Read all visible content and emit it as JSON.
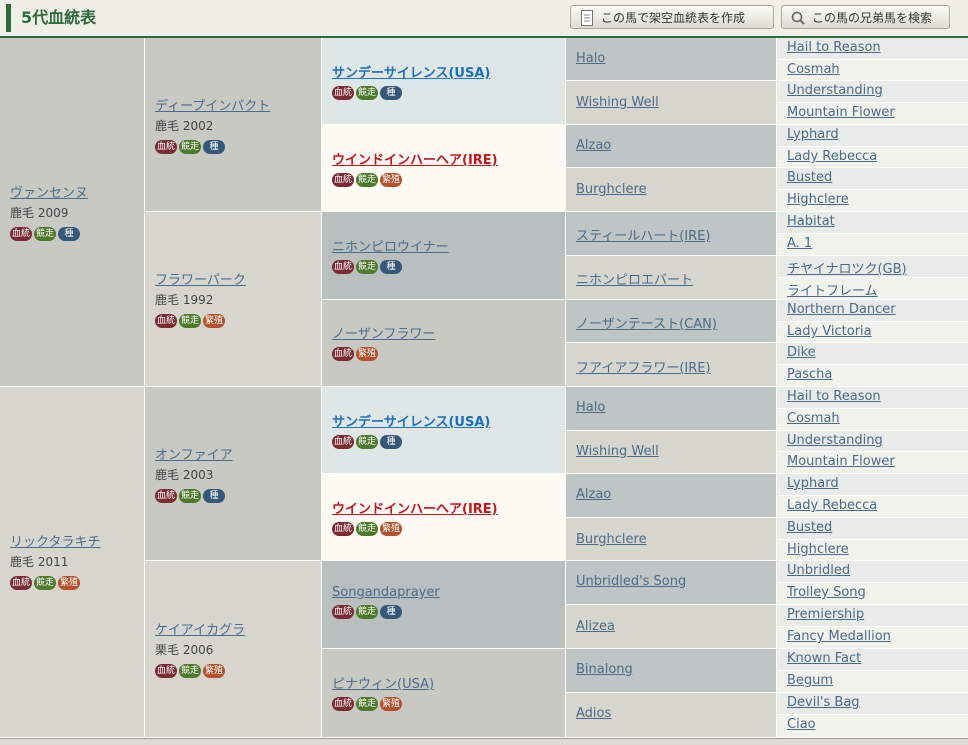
{
  "header": {
    "title": "5代血統表",
    "btn_create": "この馬で架空血統表を作成",
    "btn_search": "この馬の兄弟馬を検索"
  },
  "badges": {
    "blood": "血統",
    "race": "競走",
    "stud": "種",
    "breed": "繁殖"
  },
  "g1": [
    {
      "name": "ヴァンセンヌ",
      "info": "鹿毛 2009"
    },
    {
      "name": "リックタラキチ",
      "info": "鹿毛 2011"
    }
  ],
  "g2": [
    {
      "name": "ディープインパクト",
      "info": "鹿毛 2002"
    },
    {
      "name": "フラワーパーク",
      "info": "鹿毛 1992"
    },
    {
      "name": "オンファイア",
      "info": "鹿毛 2003"
    },
    {
      "name": "ケイアイカグラ",
      "info": "栗毛 2006"
    }
  ],
  "g3": [
    "サンデーサイレンス(USA)",
    "ウインドインハーヘア(IRE)",
    "ニホンピロウイナー",
    "ノーザンフラワー",
    "サンデーサイレンス(USA)",
    "ウインドインハーヘア(IRE)",
    "Songandaprayer",
    "ピナウィン(USA)"
  ],
  "g4": [
    "Halo",
    "Wishing Well",
    "Alzao",
    "Burghclere",
    "スティールハート(IRE)",
    "ニホンピロエバート",
    "ノーザンテースト(CAN)",
    "フアイアフラワー(IRE)",
    "Halo",
    "Wishing Well",
    "Alzao",
    "Burghclere",
    "Unbridled's Song",
    "Alizea",
    "Binalong",
    "Adios"
  ],
  "g5": [
    "Hail to Reason",
    "Cosmah",
    "Understanding",
    "Mountain Flower",
    "Lyphard",
    "Lady Rebecca",
    "Busted",
    "Highclere",
    "Habitat",
    "A. 1",
    "チヤイナロツク(GB)",
    "ライトフレーム",
    "Northern Dancer",
    "Lady Victoria",
    "Dike",
    "Pascha",
    "Hail to Reason",
    "Cosmah",
    "Understanding",
    "Mountain Flower",
    "Lyphard",
    "Lady Rebecca",
    "Busted",
    "Highclere",
    "Unbridled",
    "Trolley Song",
    "Premiership",
    "Fancy Medallion",
    "Known Fact",
    "Begum",
    "Devil's Bag",
    "Ciao"
  ]
}
